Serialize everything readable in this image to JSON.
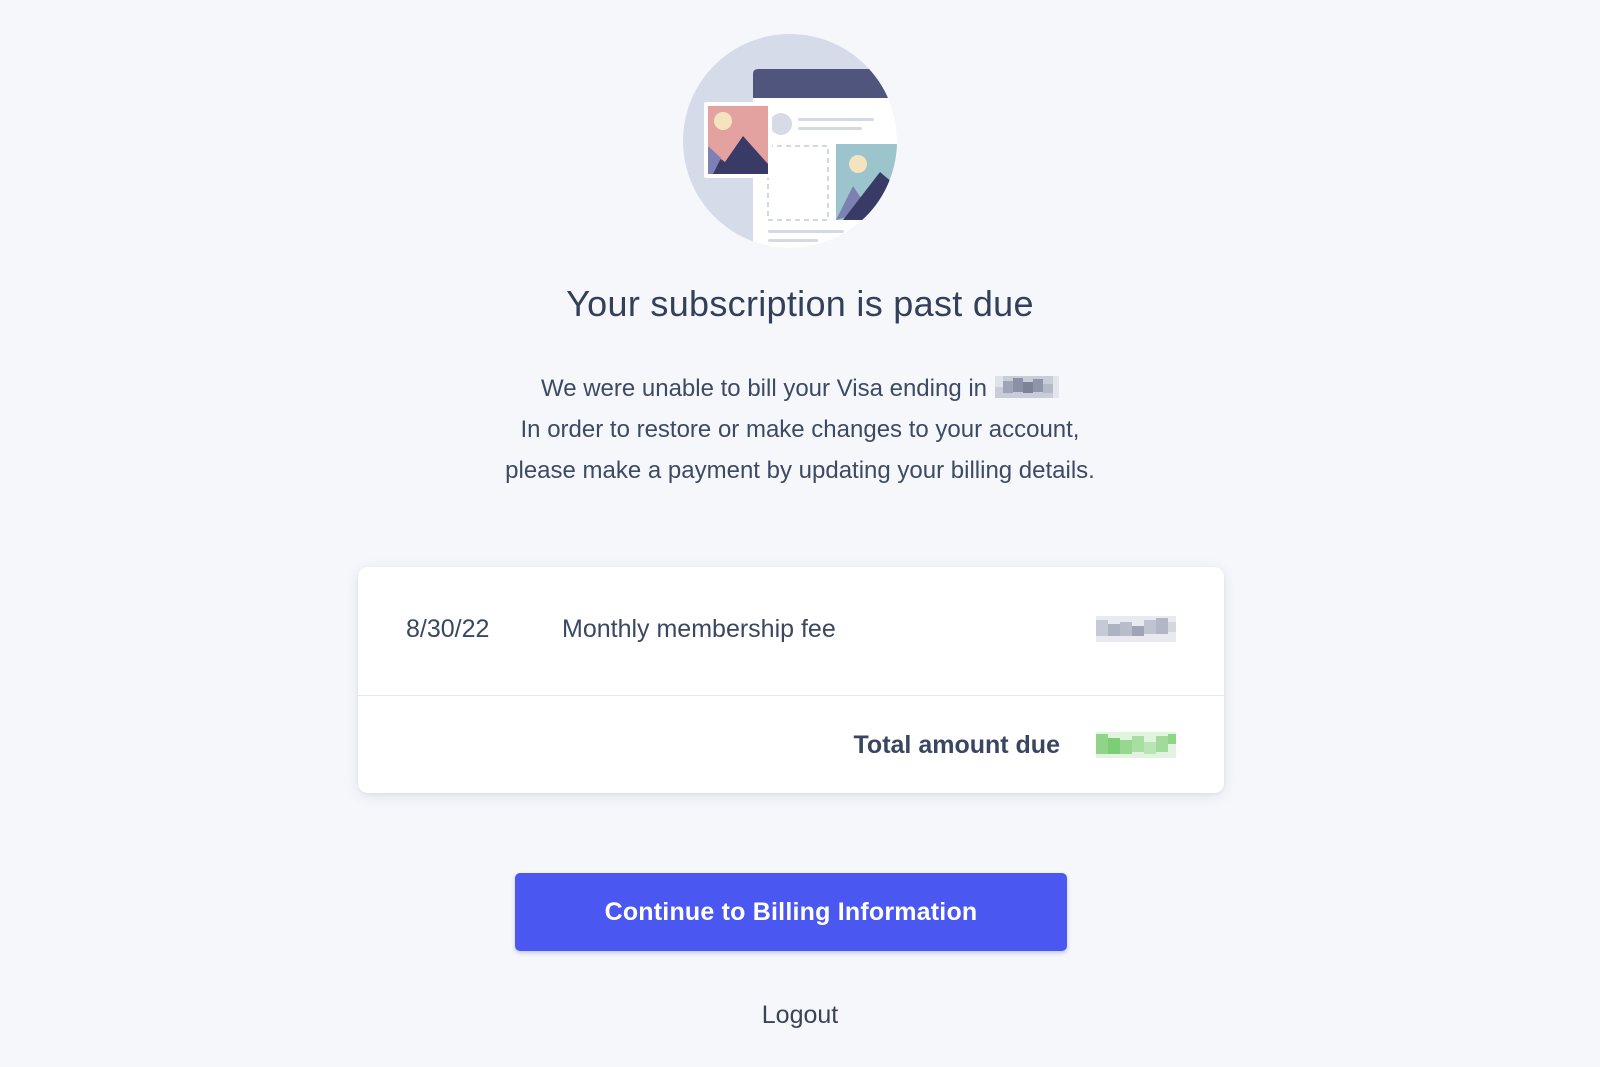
{
  "illustration": {
    "icon": "document-photos-illustration-icon",
    "colors": {
      "circle": "#d5dbe8",
      "header_bar": "#4f557d",
      "photo_pink": "#e3a19f",
      "photo_teal": "#9cc4cc",
      "mountain": "#393a66",
      "mountain_light": "#7c80b3",
      "sun": "#f3e3bf"
    }
  },
  "header": {
    "title": "Your subscription is past due"
  },
  "message": {
    "line1": "We were unable to bill your Visa ending in",
    "line2": "In order to restore or make changes to your account,",
    "line3": "please make a payment by updating your billing details."
  },
  "invoice": {
    "charge": {
      "date": "8/30/22",
      "description": "Monthly membership fee"
    },
    "total": {
      "label": "Total amount due"
    }
  },
  "actions": {
    "continue_label": "Continue to Billing Information",
    "logout_label": "Logout"
  },
  "colors": {
    "background": "#f6f7fb",
    "primary_button": "#4a58f1",
    "text": "#3a4458",
    "total_amount_accent": "#7bcf72"
  }
}
